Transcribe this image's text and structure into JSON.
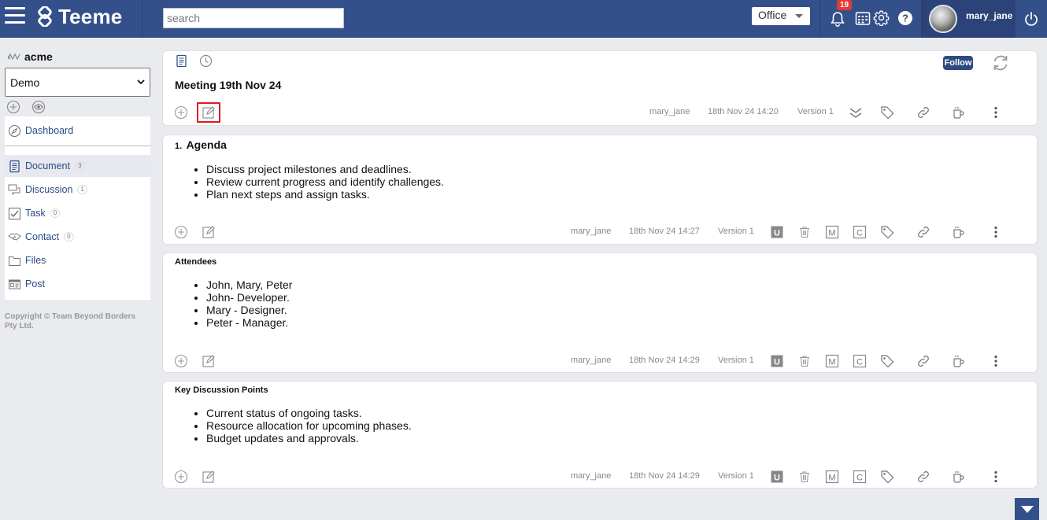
{
  "app": {
    "name": "Teeme"
  },
  "header": {
    "search_placeholder": "search",
    "workspace": "Office",
    "notification_count": "19",
    "username": "mary_jane"
  },
  "sidebar": {
    "org": "acme",
    "space": "Demo",
    "dashboard": "Dashboard",
    "items": [
      {
        "label": "Document",
        "count": "3",
        "icon": "document-icon"
      },
      {
        "label": "Discussion",
        "count": "1",
        "icon": "discussion-icon"
      },
      {
        "label": "Task",
        "count": "0",
        "icon": "task-icon"
      },
      {
        "label": "Contact",
        "count": "0",
        "icon": "contact-icon"
      },
      {
        "label": "Files",
        "icon": "folder-icon"
      },
      {
        "label": "Post",
        "icon": "post-icon"
      }
    ],
    "copyright": "Copyright © Team Beyond Borders Pty Ltd."
  },
  "document": {
    "title": "Meeting 19th Nov 24",
    "follow_label": "Follow",
    "author": "mary_jane",
    "timestamp": "18th Nov 24 14:20",
    "version": "Version 1"
  },
  "sections": [
    {
      "number": "1.",
      "title": "Agenda",
      "items": [
        "Discuss project milestones and deadlines.",
        "Review current progress and identify challenges.",
        "Plan next steps and assign tasks."
      ],
      "author": "mary_jane",
      "timestamp": "18th Nov 24 14:27",
      "version": "Version 1"
    },
    {
      "title": "Attendees",
      "items": [
        "John, Mary, Peter",
        "John- Developer.",
        "Mary - Designer.",
        "Peter - Manager."
      ],
      "author": "mary_jane",
      "timestamp": "18th Nov 24 14:29",
      "version": "Version 1"
    },
    {
      "title": "Key Discussion Points",
      "items": [
        "Current status of ongoing tasks.",
        "Resource allocation for upcoming phases.",
        "Budget updates and approvals."
      ],
      "author": "mary_jane",
      "timestamp": "18th Nov 24 14:29",
      "version": "Version 1"
    }
  ],
  "colors": {
    "topbar": "#34508a",
    "link": "#2b4a86",
    "highlight": "#e31b1b",
    "badge": "#e53935"
  }
}
